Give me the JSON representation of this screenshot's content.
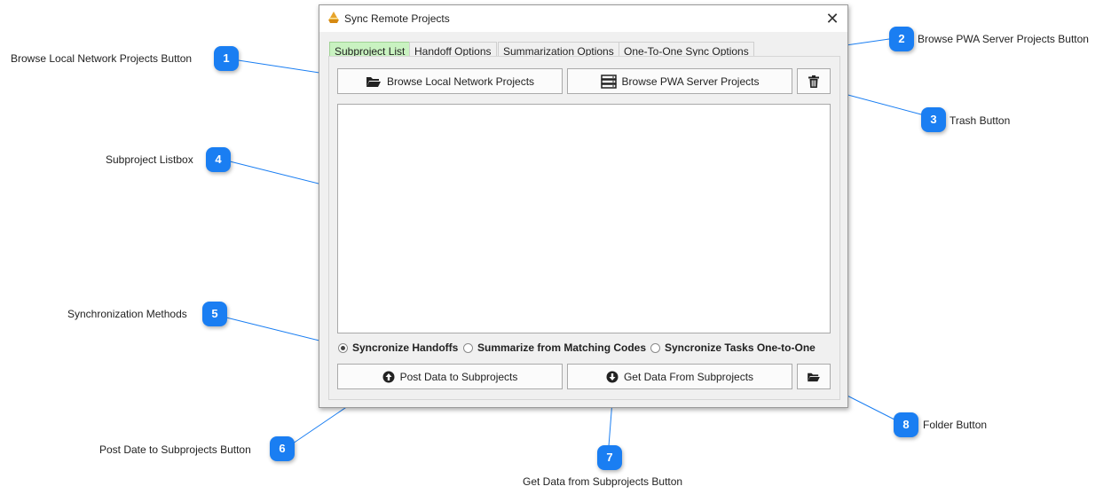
{
  "window": {
    "title": "Sync Remote Projects",
    "close_glyph": "✕",
    "tabs": [
      "Subproject List",
      "Handoff Options",
      "Summarization Options",
      "One-To-One Sync Options"
    ],
    "active_tab": "Subproject List",
    "buttons": {
      "browse_local": "Browse Local Network Projects",
      "browse_pwa": "Browse PWA Server Projects",
      "post_data": "Post Data to Subprojects",
      "get_data": "Get Data From Subprojects"
    },
    "radios": [
      {
        "label": "Syncronize Handoffs",
        "checked": true
      },
      {
        "label": "Summarize from Matching Codes",
        "checked": false
      },
      {
        "label": "Syncronize Tasks One-to-One",
        "checked": false
      }
    ],
    "accent_tab_color": "#c9f2c1"
  },
  "callouts": [
    {
      "number": "1",
      "label": "Browse Local Network Projects Button"
    },
    {
      "number": "2",
      "label": "Browse PWA Server Projects Button"
    },
    {
      "number": "3",
      "label": "Trash Button"
    },
    {
      "number": "4",
      "label": "Subproject Listbox"
    },
    {
      "number": "5",
      "label": "Synchronization Methods"
    },
    {
      "number": "6",
      "label": "Post Date to Subprojects Button"
    },
    {
      "number": "7",
      "label": "Get Data from Subprojects Button"
    },
    {
      "number": "8",
      "label": "Folder Button"
    }
  ],
  "callout_color": "#1a7ef2"
}
